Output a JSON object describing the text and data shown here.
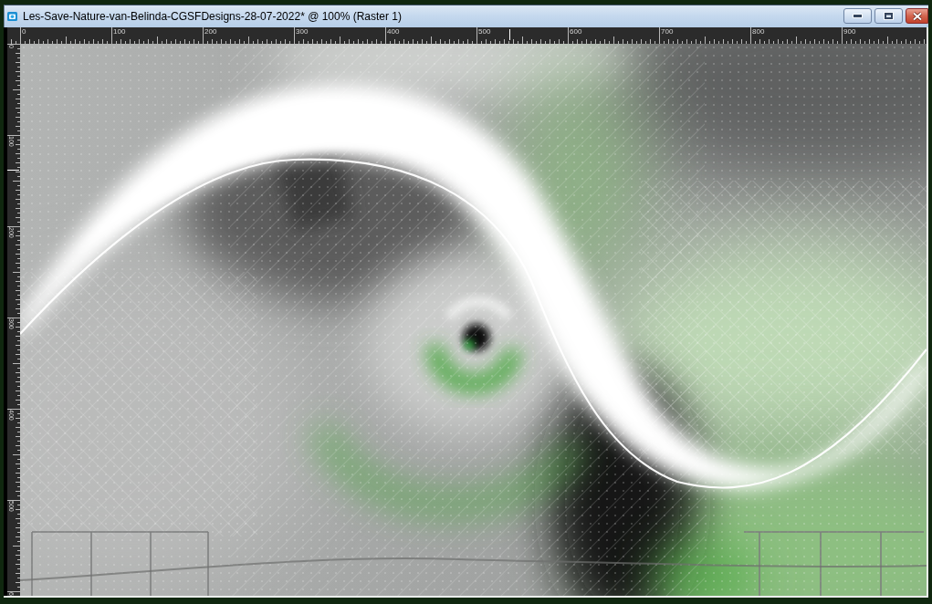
{
  "window": {
    "title": "Les-Save-Nature-van-Belinda-CGSFDesigns-28-07-2022* @ 100% (Raster 1)",
    "buttons": [
      {
        "kind": "minimize"
      },
      {
        "kind": "maximize"
      },
      {
        "kind": "close"
      }
    ]
  },
  "rulers": {
    "horizontal": {
      "labels": [
        "0",
        "100",
        "200",
        "300",
        "400",
        "500",
        "600",
        "700",
        "800",
        "900"
      ]
    },
    "vertical": {
      "labels": [
        "0",
        "100",
        "200",
        "300",
        "400",
        "500",
        "6"
      ]
    }
  }
}
